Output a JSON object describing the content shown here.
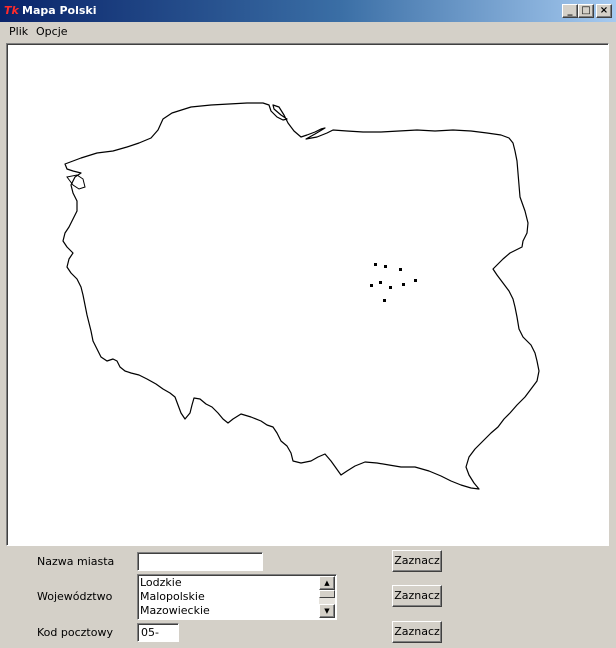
{
  "window": {
    "title": "Mapa Polski",
    "icon_label": "Tk",
    "controls": {
      "minimize": "_",
      "maximize": "□",
      "close": "×"
    }
  },
  "menu": {
    "items": [
      "Plik",
      "Opcje"
    ]
  },
  "map": {
    "outline_color": "#000000",
    "city_marker_count": 9
  },
  "form": {
    "city": {
      "label": "Nazwa miasta",
      "value": "",
      "button": "Zaznacz"
    },
    "region": {
      "label": "Województwo",
      "options": [
        "Lodzkie",
        "Malopolskie",
        "Mazowieckie"
      ],
      "scroll_up": "▲",
      "scroll_down": "▼",
      "button": "Zaznacz"
    },
    "zip": {
      "label": "Kod pocztowy",
      "value": "05-",
      "button": "Zaznacz"
    }
  }
}
